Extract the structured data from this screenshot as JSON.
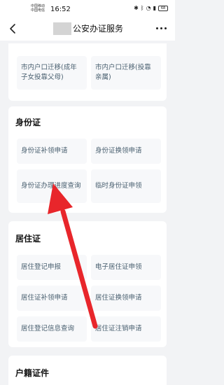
{
  "status_bar": {
    "carrier_1": "中国移动",
    "carrier_2": "中国电信",
    "time": "16:52",
    "icons": [
      "notification-icon",
      "bluetooth-icon",
      "wifi-icon",
      "signal-icon"
    ],
    "battery": "68"
  },
  "nav": {
    "back_icon": "chevron-left-icon",
    "title": "公安办证服务",
    "more_icon": "more-dots-icon"
  },
  "sections": [
    {
      "items": [
        "市内户口迁移(成年子女投靠父母)",
        "市内户口迁移(投靠亲属)"
      ]
    },
    {
      "title": "身份证",
      "items": [
        "身份证补领申请",
        "身份证换领申请",
        "身份证办理进度查询",
        "临时身份证申领"
      ]
    },
    {
      "title": "居住证",
      "items": [
        "居住登记申报",
        "电子居住证申领",
        "居住证补领申请",
        "居住证换领申请",
        "居住登记信息查询",
        "居住证注销申请"
      ]
    },
    {
      "title": "户籍证件"
    }
  ],
  "colors": {
    "background": "#f2f3f5",
    "card": "#ffffff",
    "item_bg": "#f7f8fa",
    "item_text": "#4a6070",
    "arrow": "#e8262b"
  }
}
